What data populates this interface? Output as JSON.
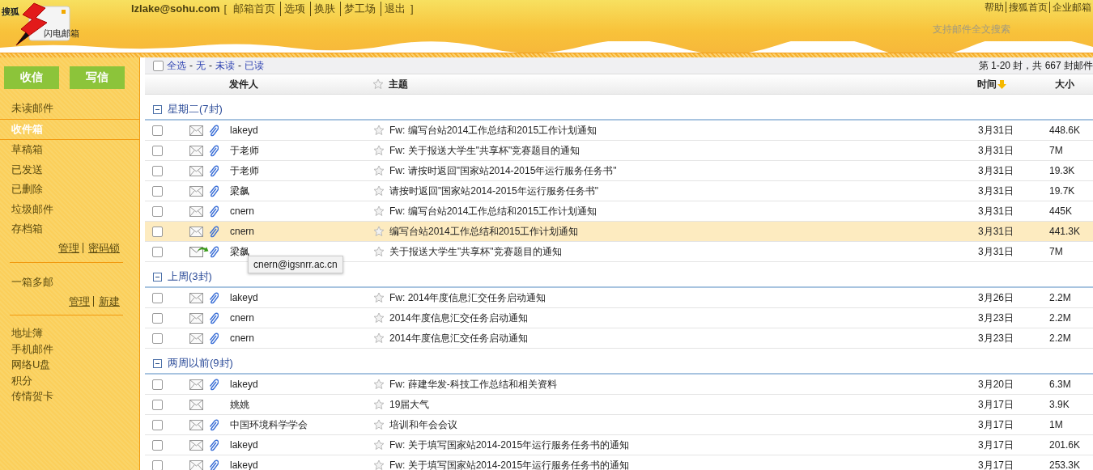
{
  "logo": {
    "brand": "搜狐",
    "name": "闪电邮箱"
  },
  "account": {
    "email": "lzlake@sohu.com",
    "open": "[",
    "close": "]",
    "links": [
      "邮箱首页",
      "选项",
      "换肤",
      "梦工场",
      "退出"
    ]
  },
  "top_links": [
    "帮助",
    "搜狐首页",
    "企业邮箱"
  ],
  "search_hint": "支持邮件全文搜索",
  "sidebar": {
    "buttons": [
      "收信",
      "写信"
    ],
    "folders": [
      {
        "label": "未读邮件",
        "selected": false
      },
      {
        "label": "收件箱",
        "selected": true
      },
      {
        "label": "草稿箱",
        "selected": false
      },
      {
        "label": "已发送",
        "selected": false
      },
      {
        "label": "已删除",
        "selected": false
      },
      {
        "label": "垃圾邮件",
        "selected": false
      },
      {
        "label": "存档箱",
        "selected": false
      }
    ],
    "folder_links": [
      "管理",
      "密码锁"
    ],
    "multi": "一箱多邮",
    "multi_links": [
      "管理",
      "新建"
    ],
    "tools": [
      "地址簿",
      "手机邮件",
      "网络U盘",
      "积分",
      "传情贺卡"
    ]
  },
  "select_bar": {
    "checked": false,
    "separator": "-",
    "links": [
      "全选",
      "无",
      "未读",
      "已读"
    ]
  },
  "pager": "第 1-20 封，共 667 封邮件",
  "columns": {
    "sender": "发件人",
    "subject": "主题",
    "time": "时间",
    "size": "大小"
  },
  "groups": [
    {
      "title": "星期二(7封)",
      "expanded": true,
      "rows": [
        {
          "kind": "read",
          "attachment": true,
          "sender": "lakeyd",
          "subject": "Fw: 编写台站2014工作总结和2015工作计划通知",
          "date": "3月31日",
          "size": "448.6K",
          "checked": false,
          "highlighted": false
        },
        {
          "kind": "read",
          "attachment": true,
          "sender": "于老师",
          "subject": "Fw: 关于报送大学生\"共享杯\"竞赛题目的通知",
          "date": "3月31日",
          "size": "7M",
          "checked": false,
          "highlighted": false
        },
        {
          "kind": "read",
          "attachment": true,
          "sender": "于老师",
          "subject": "Fw: 请按时返回\"国家站2014-2015年运行服务任务书\"",
          "date": "3月31日",
          "size": "19.3K",
          "checked": false,
          "highlighted": false
        },
        {
          "kind": "read",
          "attachment": true,
          "sender": "梁飙",
          "subject": "请按时返回\"国家站2014-2015年运行服务任务书\"",
          "date": "3月31日",
          "size": "19.7K",
          "checked": false,
          "highlighted": false
        },
        {
          "kind": "read",
          "attachment": true,
          "sender": "cnern",
          "subject": "Fw: 编写台站2014工作总结和2015工作计划通知",
          "date": "3月31日",
          "size": "445K",
          "checked": false,
          "highlighted": false
        },
        {
          "kind": "read",
          "attachment": true,
          "sender": "cnern",
          "subject": "编写台站2014工作总结和2015工作计划通知",
          "date": "3月31日",
          "size": "441.3K",
          "checked": false,
          "highlighted": true
        },
        {
          "kind": "replied",
          "attachment": true,
          "sender": "梁飙",
          "subject": "关于报送大学生\"共享杯\"竞赛题目的通知",
          "date": "3月31日",
          "size": "7M",
          "checked": false,
          "highlighted": false
        }
      ]
    },
    {
      "title": "上周(3封)",
      "expanded": true,
      "rows": [
        {
          "kind": "read",
          "attachment": true,
          "sender": "lakeyd",
          "subject": "Fw: 2014年度信息汇交任务启动通知",
          "date": "3月26日",
          "size": "2.2M",
          "checked": false,
          "highlighted": false
        },
        {
          "kind": "read",
          "attachment": true,
          "sender": "cnern",
          "subject": "2014年度信息汇交任务启动通知",
          "date": "3月23日",
          "size": "2.2M",
          "checked": false,
          "highlighted": false
        },
        {
          "kind": "read",
          "attachment": true,
          "sender": "cnern",
          "subject": "2014年度信息汇交任务启动通知",
          "date": "3月23日",
          "size": "2.2M",
          "checked": false,
          "highlighted": false
        }
      ]
    },
    {
      "title": "两周以前(9封)",
      "expanded": true,
      "rows": [
        {
          "kind": "read",
          "attachment": true,
          "sender": "lakeyd",
          "subject": "Fw: 薛建华发-科技工作总结和相关资料",
          "date": "3月20日",
          "size": "6.3M",
          "checked": false,
          "highlighted": false
        },
        {
          "kind": "read",
          "attachment": false,
          "sender": "姚姚",
          "subject": "19届大气",
          "date": "3月17日",
          "size": "3.9K",
          "checked": false,
          "highlighted": false
        },
        {
          "kind": "read",
          "attachment": true,
          "sender": "中国环境科学学会",
          "subject": "培训和年会会议",
          "date": "3月17日",
          "size": "1M",
          "checked": false,
          "highlighted": false
        },
        {
          "kind": "read",
          "attachment": true,
          "sender": "lakeyd",
          "subject": "Fw: 关于填写国家站2014-2015年运行服务任务书的通知",
          "date": "3月17日",
          "size": "201.6K",
          "checked": false,
          "highlighted": false
        },
        {
          "kind": "read",
          "attachment": true,
          "sender": "lakeyd",
          "subject": "Fw: 关于填写国家站2014-2015年运行服务任务书的通知",
          "date": "3月17日",
          "size": "253.3K",
          "checked": false,
          "highlighted": false
        }
      ]
    }
  ],
  "tooltip": "cnern@igsnrr.ac.cn"
}
